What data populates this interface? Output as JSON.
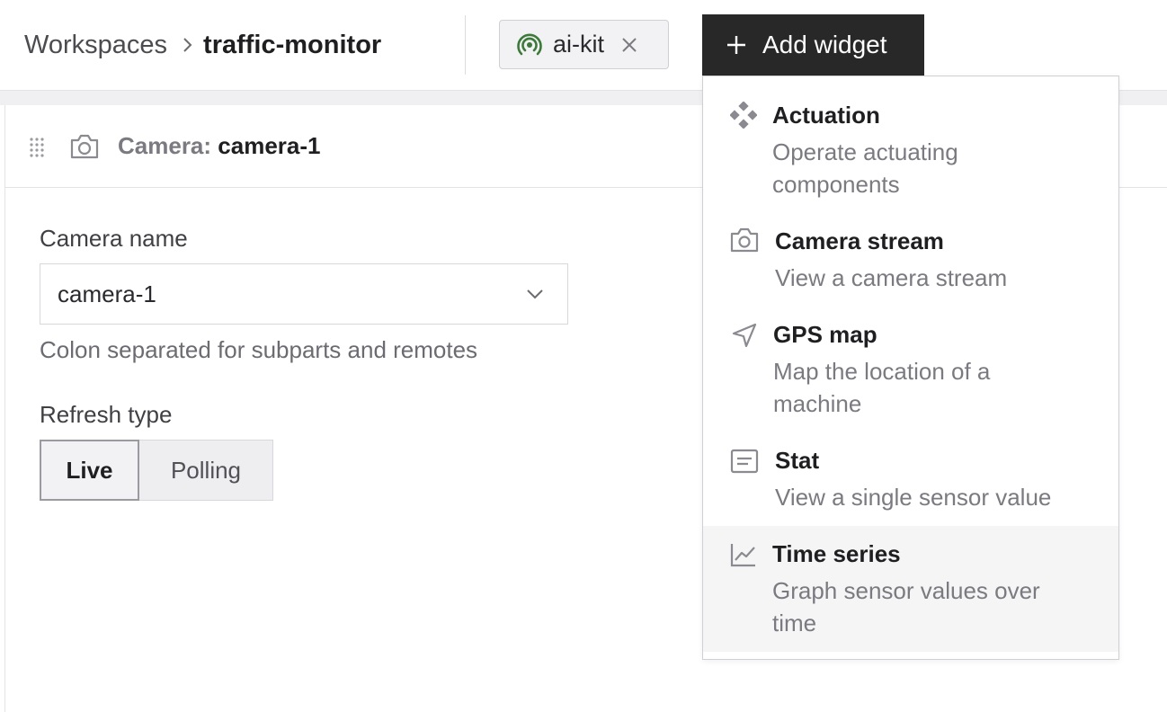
{
  "breadcrumb": {
    "root": "Workspaces",
    "current": "traffic-monitor"
  },
  "machine_chip": {
    "label": "ai-kit",
    "status_icon": "online-signal-icon",
    "status_color": "#3d7a3a"
  },
  "toolbar": {
    "add_widget_label": "Add widget"
  },
  "card": {
    "title_prefix": "Camera:",
    "title_name": "camera-1",
    "camera_name_label": "Camera name",
    "camera_name_value": "camera-1",
    "helper_text": "Colon separated for subparts and remotes",
    "refresh_label": "Refresh type",
    "refresh_options": [
      "Live",
      "Polling"
    ],
    "refresh_selected": "Live"
  },
  "widget_menu": {
    "items": [
      {
        "title": "Actuation",
        "desc_lines": [
          "Operate actuating",
          "components"
        ],
        "icon": "gamepad-icon"
      },
      {
        "title": "Camera stream",
        "desc_lines": [
          "View a camera stream"
        ],
        "icon": "camera-icon"
      },
      {
        "title": "GPS map",
        "desc_lines": [
          "Map the location of a",
          "machine"
        ],
        "icon": "navigation-arrow-icon"
      },
      {
        "title": "Stat",
        "desc_lines": [
          "View a single sensor value"
        ],
        "icon": "text-box-icon"
      },
      {
        "title": "Time series",
        "desc_lines": [
          "Graph sensor values over",
          "time"
        ],
        "icon": "line-chart-icon"
      }
    ],
    "highlighted": "Time series"
  },
  "colors": {
    "button_dark": "#282828",
    "menu_highlight": "#f5f5f6",
    "muted_text": "#7a7a80"
  }
}
